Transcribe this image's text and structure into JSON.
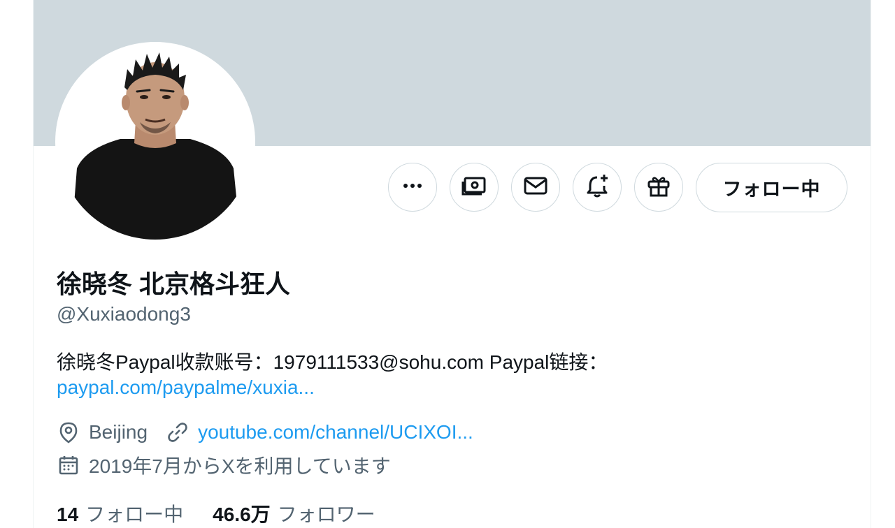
{
  "profile": {
    "display_name": "徐晓冬 北京格斗狂人",
    "handle": "@Xuxiaodong3",
    "bio": "徐晓冬Paypal收款账号：1979111533@sohu.com Paypal链接：",
    "bio_link": "paypal.com/paypalme/xuxia...",
    "location": "Beijing",
    "website": "youtube.com/channel/UCIXOI...",
    "joined": "2019年7月からXを利用しています",
    "following_count": "14",
    "following_label": "フォロー中",
    "followers_count": "46.6万",
    "followers_label": "フォロワー"
  },
  "actions": {
    "more_icon": "more-icon",
    "subscribe_icon": "money-icon",
    "message_icon": "mail-icon",
    "notify_icon": "bell-plus-icon",
    "gift_icon": "gift-icon",
    "follow_label": "フォロー中"
  },
  "colors": {
    "banner": "#cfd9de",
    "link": "#1d9bf0",
    "secondary_text": "#536471",
    "primary_text": "#0f1419",
    "border": "#cfd9de"
  }
}
